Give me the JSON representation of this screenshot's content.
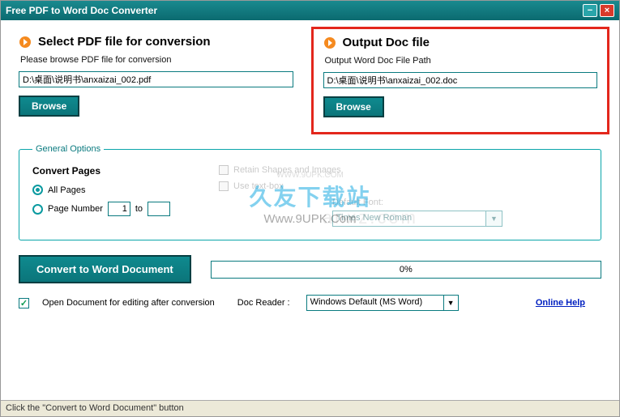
{
  "window": {
    "title": "Free PDF to Word Doc Converter"
  },
  "input_section": {
    "heading": "Select PDF file for conversion",
    "sublabel": "Please browse PDF file for conversion",
    "path": "D:\\桌面\\说明书\\anxaizai_002.pdf",
    "browse": "Browse"
  },
  "output_section": {
    "heading": "Output Doc file",
    "sublabel": "Output Word Doc File Path",
    "path": "D:\\桌面\\说明书\\anxaizai_002.doc",
    "browse": "Browse"
  },
  "options": {
    "legend": "General Options",
    "convert_pages_label": "Convert Pages",
    "all_pages": "All Pages",
    "page_number": "Page Number",
    "page_from": "1",
    "to_label": "to",
    "page_to": "",
    "retain_shapes": "Retain Shapes and Images",
    "use_text_box": "Use text-box",
    "default_font_label": "Default Font:",
    "font": "Times New Roman"
  },
  "actions": {
    "convert": "Convert to Word Document",
    "progress": "0%"
  },
  "footer": {
    "open_after": "Open Document for editing after conversion",
    "reader_label": "Doc Reader :",
    "reader": "Windows Default (MS Word)",
    "help": "Online Help"
  },
  "status": "Click the \"Convert to Word Document\" button",
  "watermark": {
    "small": "WWW.9UPK.COM",
    "cn": "久友下载站",
    "url": "Www.9UPK.Com",
    "bg": "anxz.com"
  }
}
